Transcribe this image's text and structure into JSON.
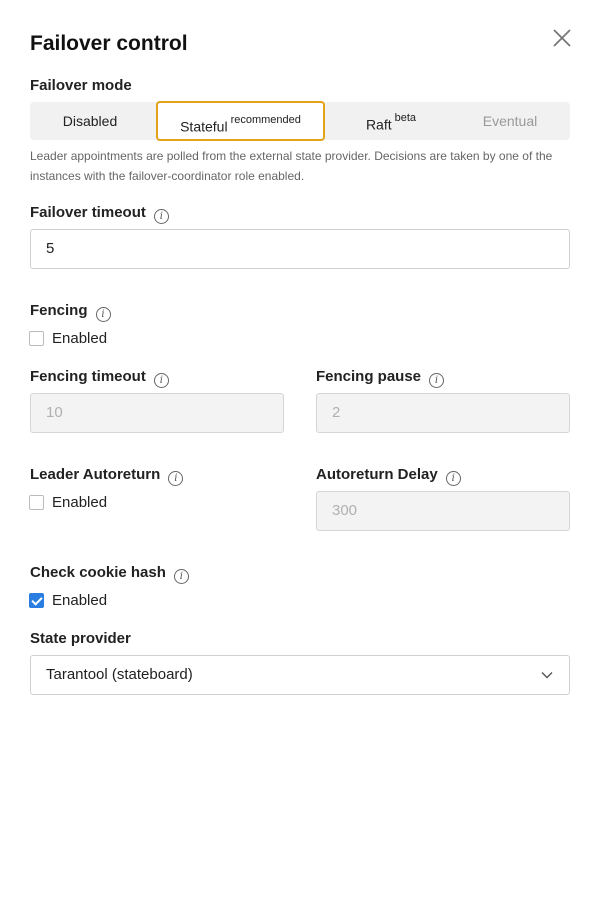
{
  "dialog": {
    "title": "Failover control"
  },
  "failover_mode": {
    "label": "Failover mode",
    "options": [
      {
        "label": "Disabled",
        "sup": "",
        "state": "normal"
      },
      {
        "label": "Stateful",
        "sup": "recommended",
        "state": "selected"
      },
      {
        "label": "Raft",
        "sup": "beta",
        "state": "normal"
      },
      {
        "label": "Eventual",
        "sup": "",
        "state": "disabled"
      }
    ],
    "help": "Leader appointments are polled from the external state provider. Decisions are taken by one of the instances with the failover-coordinator role enabled."
  },
  "failover_timeout": {
    "label": "Failover timeout",
    "value": "5"
  },
  "fencing": {
    "label": "Fencing",
    "checkbox_label": "Enabled",
    "checked": false
  },
  "fencing_timeout": {
    "label": "Fencing timeout",
    "value": "10"
  },
  "fencing_pause": {
    "label": "Fencing pause",
    "value": "2"
  },
  "leader_autoreturn": {
    "label": "Leader Autoreturn",
    "checkbox_label": "Enabled",
    "checked": false
  },
  "autoreturn_delay": {
    "label": "Autoreturn Delay",
    "value": "300"
  },
  "check_cookie_hash": {
    "label": "Check cookie hash",
    "checkbox_label": "Enabled",
    "checked": true
  },
  "state_provider": {
    "label": "State provider",
    "value": "Tarantool (stateboard)"
  },
  "icons": {
    "info": "info-icon",
    "close": "close-icon",
    "chevron": "chevron-down-icon",
    "check": "checkmark-icon"
  },
  "colors": {
    "selected_border": "#e3a21a",
    "checkbox_checked": "#2a7de1",
    "segment_bg": "#f1f1f1"
  }
}
